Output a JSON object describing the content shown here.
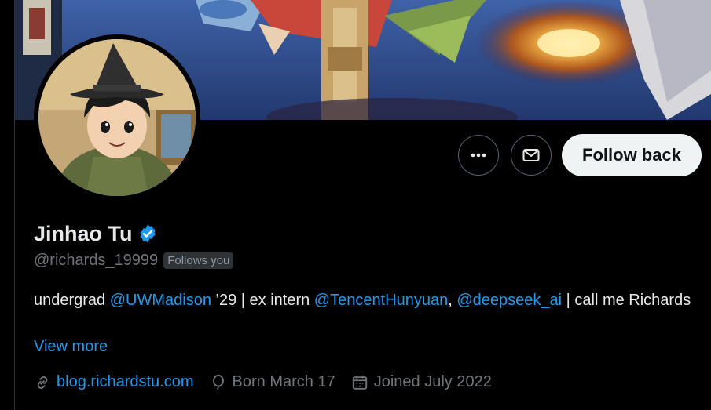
{
  "profile": {
    "name": "Jinhao Tu",
    "handle": "@richards_19999",
    "follows_you": "Follows you",
    "verified": true
  },
  "actions": {
    "more_icon": "more-icon",
    "message_icon": "envelope-icon",
    "follow_label": "Follow back"
  },
  "bio": {
    "t1": "undergrad ",
    "m1": "@UWMadison",
    "t2": " ’29 | ex intern ",
    "m2": "@TencentHunyuan",
    "t3": ", ",
    "m3": "@deepseek_ai",
    "t4": " | call me Richards",
    "view_more": "View more"
  },
  "meta": {
    "link": "blog.richardstu.com",
    "birthday": "Born March 17",
    "joined": "Joined July 2022"
  },
  "colors": {
    "accent": "#1d9bf0",
    "background": "#000000",
    "text": "#e7e9ea",
    "muted": "#71767b"
  }
}
